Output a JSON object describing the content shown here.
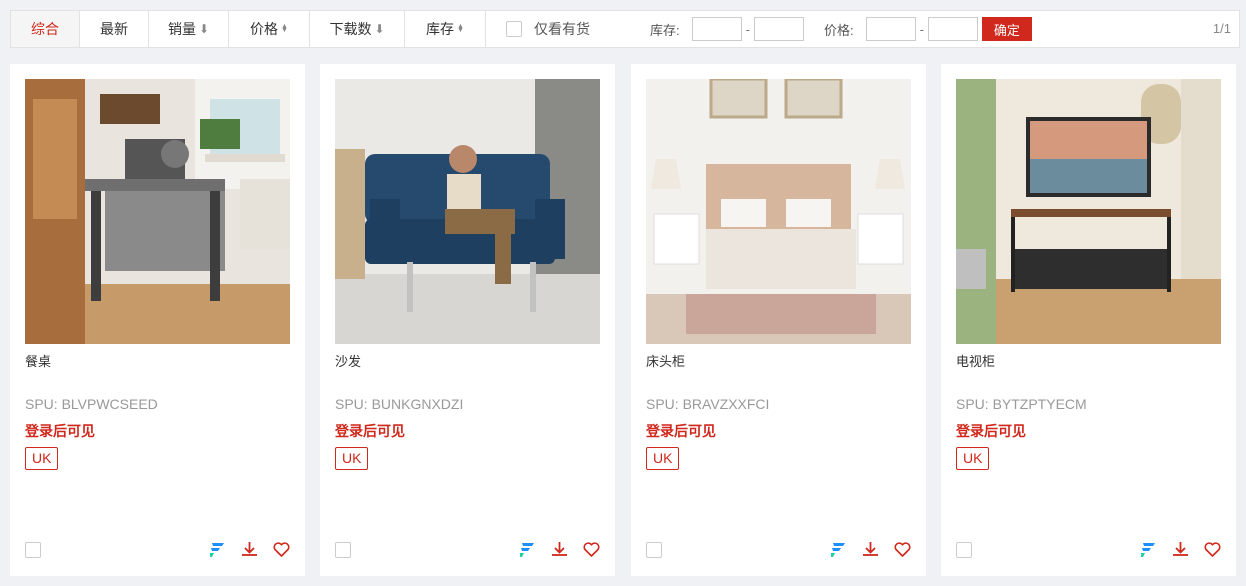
{
  "filter_bar": {
    "tabs": [
      {
        "label": "综合",
        "indicator": "none",
        "active": true
      },
      {
        "label": "最新",
        "indicator": "none",
        "active": false
      },
      {
        "label": "销量",
        "indicator": "arrow-down",
        "active": false
      },
      {
        "label": "价格",
        "indicator": "up-down",
        "active": false
      },
      {
        "label": "下载数",
        "indicator": "arrow-down",
        "active": false
      },
      {
        "label": "库存",
        "indicator": "up-down",
        "active": false
      }
    ],
    "in_stock_only_label": "仅看有货",
    "in_stock_only_checked": false,
    "stock_range": {
      "label": "库存:",
      "min": "",
      "max": "",
      "separator": "-"
    },
    "price_range": {
      "label": "价格:",
      "min": "",
      "max": "",
      "separator": "-"
    },
    "confirm_label": "确定",
    "pager": "1/1"
  },
  "products": [
    {
      "name": "餐桌",
      "spu": "SPU:  BLVPWCSEED",
      "price_note": "登录后可见",
      "tag": "UK",
      "image_icon": "dining-table-photo"
    },
    {
      "name": "沙发",
      "spu": "SPU:  BUNKGNXDZI",
      "price_note": "登录后可见",
      "tag": "UK",
      "image_icon": "sofa-photo"
    },
    {
      "name": "床头柜",
      "spu": "SPU:  BRAVZXXFCI",
      "price_note": "登录后可见",
      "tag": "UK",
      "image_icon": "bed-nightstand-photo"
    },
    {
      "name": "电视柜",
      "spu": "SPU:  BYTZPTYECM",
      "price_note": "登录后可见",
      "tag": "UK",
      "image_icon": "tv-stand-photo"
    }
  ],
  "colors": {
    "accent": "#d0281c",
    "brand_icon": "#1f8fff",
    "background": "#f0f1f5"
  },
  "card_action_icons": [
    "brand-logo-icon",
    "download-icon",
    "heart-icon"
  ]
}
